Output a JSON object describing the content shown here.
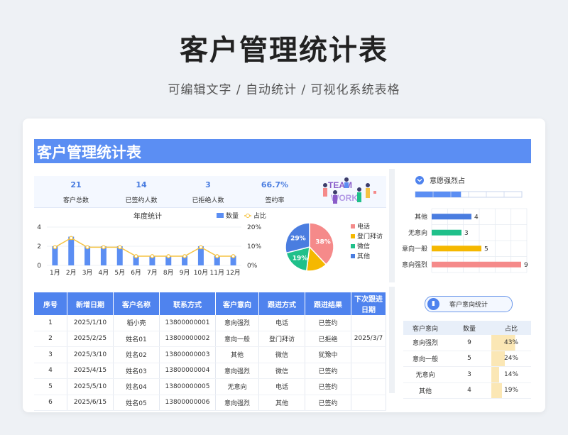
{
  "header": {
    "title": "客户管理统计表",
    "subtitle": "可编辑文字  /  自动统计  /  可视化系统表格"
  },
  "banner": {
    "title": "客户管理统计表"
  },
  "kpis": [
    {
      "value": "21",
      "label": "客户总数"
    },
    {
      "value": "14",
      "label": "已签约人数"
    },
    {
      "value": "3",
      "label": "已拒绝人数"
    },
    {
      "value": "66.7%",
      "label": "签约率"
    }
  ],
  "teamwork_text": "TEAM WORK",
  "colors": {
    "accent": "#5b8ef3",
    "bar": "#5b8ef3",
    "line": "#f5c342",
    "pink": "#f58a8a",
    "yellow": "#f5b800",
    "green": "#20c08a",
    "blue": "#4a7de0"
  },
  "chart_data": [
    {
      "type": "bar",
      "title": "年度统计",
      "categories": [
        "1月",
        "2月",
        "3月",
        "4月",
        "5月",
        "6月",
        "7月",
        "8月",
        "9月",
        "10月",
        "11月",
        "12月"
      ],
      "series": [
        {
          "name": "数量",
          "values": [
            2,
            3,
            2,
            2,
            2,
            1,
            1,
            1,
            1,
            2,
            1,
            1
          ]
        },
        {
          "name": "占比",
          "values": [
            9.5,
            14.3,
            9.5,
            9.5,
            9.5,
            4.8,
            4.8,
            4.8,
            4.8,
            9.5,
            4.8,
            4.8
          ]
        }
      ],
      "ylim": [
        0,
        4
      ],
      "y2lim": [
        0,
        20
      ],
      "yticks": [
        "0",
        "2",
        "4"
      ],
      "y2ticks": [
        "0%",
        "10%",
        "20%"
      ],
      "legend": "top-right"
    },
    {
      "type": "pie",
      "categories": [
        "电话",
        "登门拜访",
        "微信",
        "其他"
      ],
      "values": [
        38,
        14,
        19,
        29
      ],
      "labels": [
        "38%",
        "",
        "19%",
        "29%"
      ],
      "legend": "right"
    },
    {
      "type": "bar",
      "title": "意愿强烈占",
      "categories": [
        "其他",
        "无意向",
        "意向一般",
        "意向强烈"
      ],
      "values": [
        4,
        3,
        5,
        9
      ],
      "xlim": [
        0,
        9
      ]
    }
  ],
  "main_table": {
    "headers": [
      "序号",
      "新增日期",
      "客户名称",
      "联系方式",
      "客户意向",
      "跟进方式",
      "跟进结果",
      "下次跟进日期"
    ],
    "rows": [
      [
        "1",
        "2025/1/10",
        "稻小壳",
        "13800000001",
        "意向强烈",
        "电话",
        "已签约",
        ""
      ],
      [
        "2",
        "2025/2/25",
        "姓名01",
        "13800000002",
        "意向一般",
        "登门拜访",
        "已拒绝",
        "2025/3/7"
      ],
      [
        "3",
        "2025/3/10",
        "姓名02",
        "13800000003",
        "其他",
        "微信",
        "犹豫中",
        ""
      ],
      [
        "4",
        "2025/4/15",
        "姓名03",
        "13800000004",
        "意向强烈",
        "微信",
        "已签约",
        ""
      ],
      [
        "5",
        "2025/5/10",
        "姓名04",
        "13800000005",
        "无意向",
        "电话",
        "已签约",
        ""
      ],
      [
        "6",
        "2025/6/15",
        "姓名05",
        "13800000006",
        "意向强烈",
        "其他",
        "已签约",
        ""
      ]
    ]
  },
  "side": {
    "pill_label": "客户意向统计",
    "headers": [
      "客户意向",
      "数量",
      "占比"
    ],
    "rows": [
      [
        "意向强烈",
        "9",
        "43%"
      ],
      [
        "意向一般",
        "5",
        "24%"
      ],
      [
        "无意向",
        "3",
        "14%"
      ],
      [
        "其他",
        "4",
        "19%"
      ]
    ],
    "share": [
      0.43,
      0.24,
      0.14,
      0.19
    ]
  }
}
